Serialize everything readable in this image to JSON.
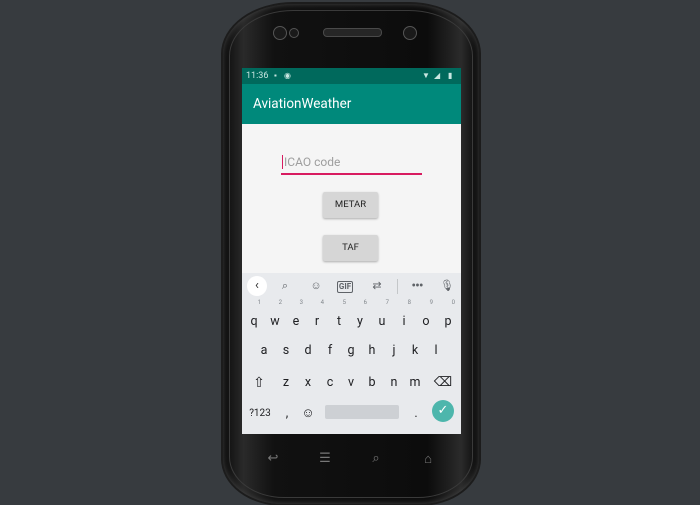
{
  "status_bar": {
    "time": "11:36",
    "left_icons": [
      "sd-card-icon",
      "sync-icon"
    ],
    "right_icons": [
      "wifi-icon",
      "signal-icon",
      "battery-icon"
    ]
  },
  "app_bar": {
    "title": "AviationWeather"
  },
  "form": {
    "icao_placeholder": "ICAO code",
    "icao_value": "",
    "metar_label": "METAR",
    "taf_label": "TAF"
  },
  "keyboard": {
    "toolbar_icons": [
      "back-icon",
      "search-icon",
      "sticker-icon",
      "gif-icon",
      "translate-icon",
      "more-icon",
      "mic-icon"
    ],
    "gif_label": "GIF",
    "row1": [
      {
        "k": "q",
        "h": "1"
      },
      {
        "k": "w",
        "h": "2"
      },
      {
        "k": "e",
        "h": "3"
      },
      {
        "k": "r",
        "h": "4"
      },
      {
        "k": "t",
        "h": "5"
      },
      {
        "k": "y",
        "h": "6"
      },
      {
        "k": "u",
        "h": "7"
      },
      {
        "k": "i",
        "h": "8"
      },
      {
        "k": "o",
        "h": "9"
      },
      {
        "k": "p",
        "h": "0"
      }
    ],
    "row2": [
      "a",
      "s",
      "d",
      "f",
      "g",
      "h",
      "j",
      "k",
      "l"
    ],
    "row3": [
      "z",
      "x",
      "c",
      "v",
      "b",
      "n",
      "m"
    ],
    "symbols_label": "?123",
    "comma": ",",
    "period": "."
  },
  "nav_bar": {
    "buttons": [
      "back-icon",
      "menu-icon",
      "search-icon",
      "home-icon"
    ]
  },
  "colors": {
    "background": "#373b3f",
    "primary": "#00897b",
    "primary_dark": "#00695c",
    "accent": "#d81b60",
    "enter_key": "#4db6ac"
  }
}
